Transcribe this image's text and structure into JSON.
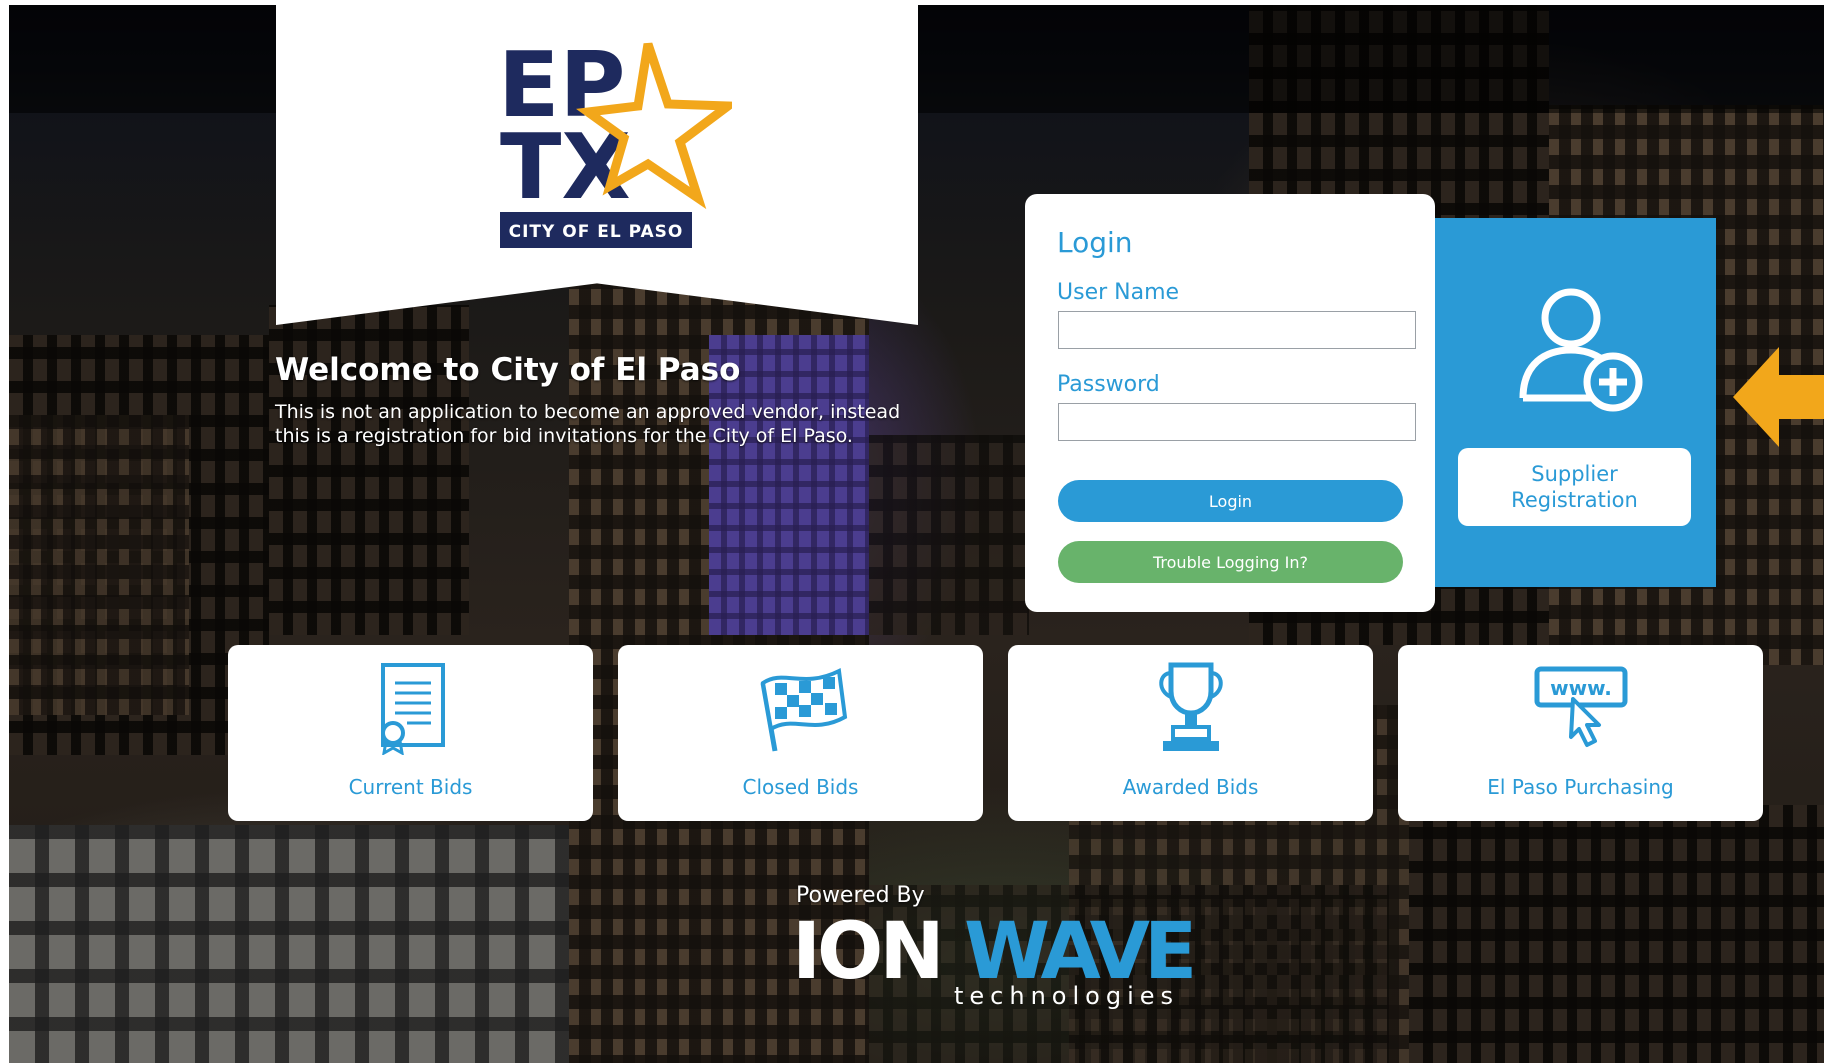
{
  "logo": {
    "line1": "EP",
    "line2": "TX",
    "banner": "CITY OF EL PASO",
    "colors": {
      "navy": "#1e2a5e",
      "gold": "#f2a71b"
    }
  },
  "welcome": {
    "title": "Welcome to City of El Paso",
    "text": "This is not an application to become an approved vendor, instead this is a registration for bid invitations for the City of El Paso."
  },
  "login": {
    "title": "Login",
    "username_label": "User Name",
    "username_value": "",
    "password_label": "Password",
    "password_value": "",
    "login_button": "Login",
    "trouble_button": "Trouble Logging In?"
  },
  "supplier": {
    "icon": "user-add-icon",
    "label_line1": "Supplier",
    "label_line2": "Registration"
  },
  "tiles": [
    {
      "label": "Current Bids",
      "icon": "certificate-icon"
    },
    {
      "label": "Closed Bids",
      "icon": "checkered-flag-icon"
    },
    {
      "label": "Awarded Bids",
      "icon": "trophy-icon"
    },
    {
      "label": "El Paso Purchasing",
      "icon": "www-cursor-icon"
    }
  ],
  "footer": {
    "powered_by": "Powered By",
    "brand_part1": "ION",
    "brand_part2": "WAVE",
    "brand_sub": "technologies"
  },
  "colors": {
    "accent_blue": "#2a9ad6",
    "button_green": "#68b36b",
    "arrow_gold": "#f2a71b"
  }
}
